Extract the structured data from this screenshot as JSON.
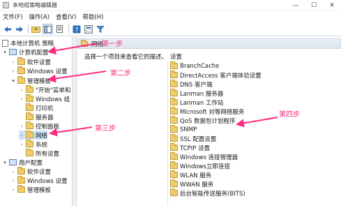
{
  "window": {
    "title": "本地组策略编辑器",
    "controls": [
      "—",
      "☐",
      "✕"
    ]
  },
  "menu": [
    "文件(F)",
    "操作(A)",
    "查看(V)",
    "帮助(H)"
  ],
  "tree": {
    "root": "本地计算机 策略",
    "computer_config": "计算机配置",
    "software_settings": "软件设置",
    "windows_settings": "Windows 设置",
    "admin_templates": "管理模板",
    "start_menu": "\"开始\"菜单和",
    "windows_components": "Windows 组",
    "printers": "打印机",
    "servers": "服务器",
    "control_panel": "控制面板",
    "network": "网络",
    "system": "系统",
    "all_settings": "所有设置",
    "user_config": "用户配置",
    "u_software_settings": "软件设置",
    "u_windows_settings": "Windows 设置",
    "u_admin_templates": "管理模板"
  },
  "right_panel": {
    "header": "网络",
    "description": "选择一个项目来查看它的描述。",
    "settings_header": "设置",
    "items": [
      "BranchCache",
      "DirectAccess 客户端体验设置",
      "DNS 客户端",
      "Lanman 服务器",
      "Lanman 工作站",
      "Microsoft 对等网络服务",
      "QoS 数据包计划程序",
      "SNMP",
      "SSL 配置设置",
      "TCPIP 设置",
      "Windows 连接管理器",
      "Windows立即连接",
      "WLAN 服务",
      "WWAN 服务",
      "后台智能传送服务(BITS)"
    ]
  },
  "annotations": {
    "step1": "第一步",
    "step2": "第二步",
    "step3": "第三步",
    "step4": "第四步"
  },
  "colors": {
    "annotation": "#ff2a80",
    "folder": "#eecb6c",
    "selection": "#cde3f7"
  }
}
